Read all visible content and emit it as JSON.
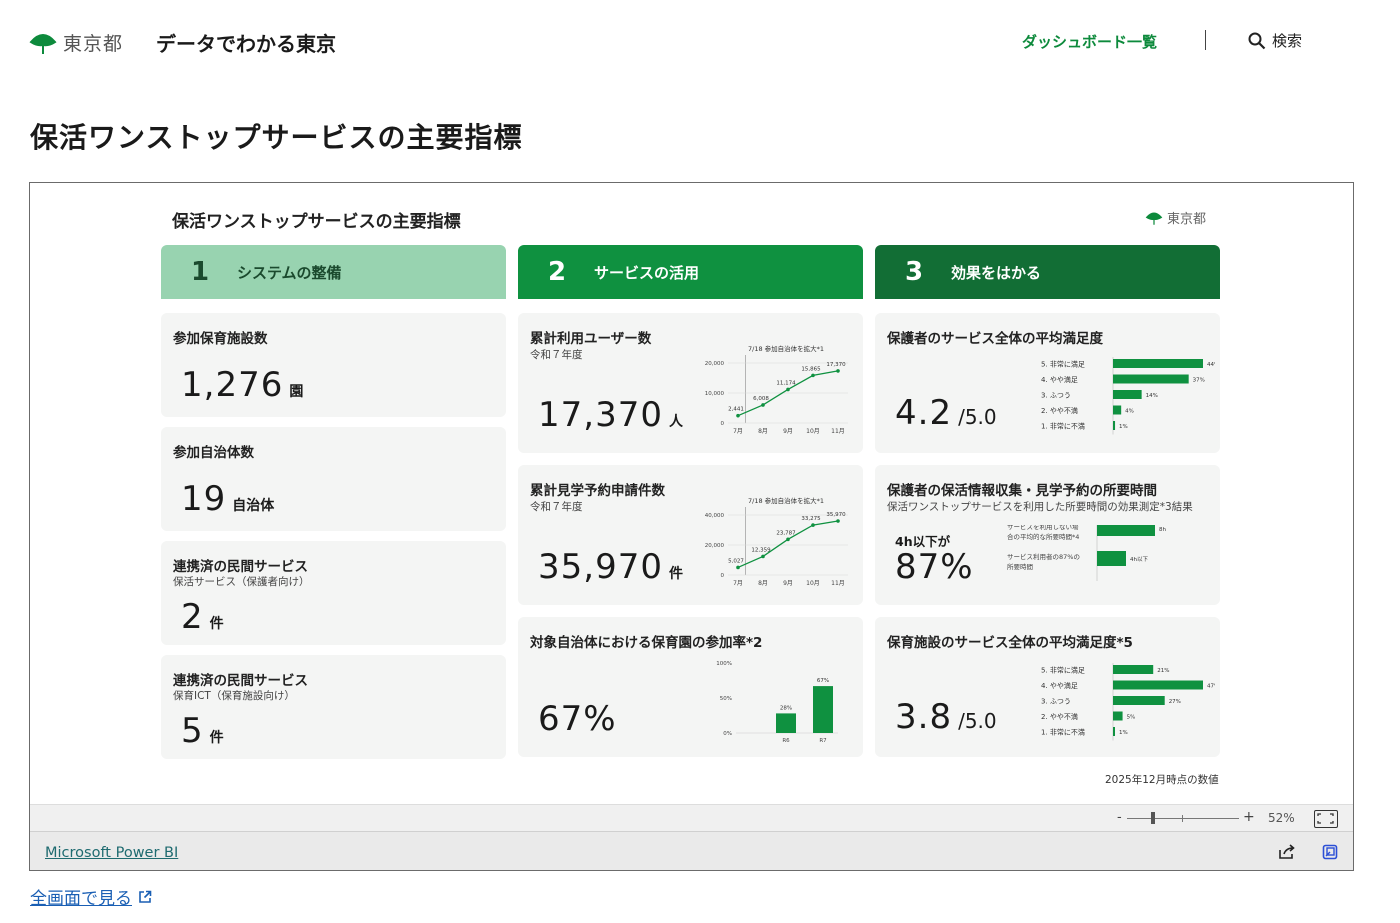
{
  "header": {
    "org_name": "東京都",
    "site_title": "データでわかる東京",
    "nav_dashboard": "ダッシュボード一覧",
    "nav_search": "検索",
    "brand_green": "#0d8a3c"
  },
  "page": {
    "title": "保活ワンストップサービスの主要指標"
  },
  "report": {
    "title": "保活ワンストップサービスの主要指標",
    "logo_text": "東京都",
    "columns": [
      {
        "num": "1",
        "label": "システムの整備",
        "color": "#98d3b0"
      },
      {
        "num": "2",
        "label": "サービスの活用",
        "color": "#0f9140"
      },
      {
        "num": "3",
        "label": "効果をはかる",
        "color": "#126e35"
      }
    ],
    "col1": {
      "facilities": {
        "title": "参加保育施設数",
        "value": "1,276",
        "unit": "園"
      },
      "municipalities": {
        "title": "参加自治体数",
        "value": "19",
        "unit": "自治体"
      },
      "services_parents": {
        "title": "連携済の民間サービス",
        "subtitle": "保活サービス（保護者向け）",
        "value": "2",
        "unit": "件"
      },
      "services_ict": {
        "title": "連携済の民間サービス",
        "subtitle": "保育ICT（保育施設向け）",
        "value": "5",
        "unit": "件"
      }
    },
    "col2": {
      "users": {
        "title": "累計利用ユーザー数",
        "subtitle": "令和７年度",
        "value": "17,370",
        "unit": "人",
        "annotation": "7/18 参加自治体を拡大*1",
        "x": [
          "7月",
          "8月",
          "9月",
          "10月",
          "11月"
        ],
        "yticks": [
          "20,000",
          "10,000",
          "0"
        ],
        "ymax": 20000,
        "points": [
          {
            "m": 0.0,
            "v": 2441,
            "label": "2,441"
          },
          {
            "m": 1.0,
            "v": 6008,
            "label": "6,008"
          },
          {
            "m": 2.0,
            "v": 11174,
            "label": "11,174"
          },
          {
            "m": 3.0,
            "v": 15865,
            "label": "15,865"
          },
          {
            "m": 4.0,
            "v": 17370,
            "label": "17,370"
          }
        ]
      },
      "visits": {
        "title": "累計見学予約申請件数",
        "subtitle": "令和７年度",
        "value": "35,970",
        "unit": "件",
        "annotation": "7/18 参加自治体を拡大*1",
        "x": [
          "7月",
          "8月",
          "9月",
          "10月",
          "11月"
        ],
        "yticks": [
          "40,000",
          "20,000",
          "0"
        ],
        "ymax": 40000,
        "points": [
          {
            "m": 0.0,
            "v": 5027,
            "label": "5,027"
          },
          {
            "m": 1.0,
            "v": 12359,
            "label": "12,359"
          },
          {
            "m": 2.0,
            "v": 23787,
            "label": "23,787"
          },
          {
            "m": 3.0,
            "v": 33275,
            "label": "33,275"
          },
          {
            "m": 4.0,
            "v": 35970,
            "label": "35,970"
          }
        ]
      },
      "participation": {
        "title": "対象自治体における保育園の参加率*2",
        "value": "67%",
        "yticks": [
          "100%",
          "50%",
          "0%"
        ],
        "bars": [
          {
            "cat": "R6",
            "v": 28,
            "label": "28%"
          },
          {
            "cat": "R7",
            "v": 67,
            "label": "67%"
          }
        ]
      }
    },
    "col3": {
      "satisfaction_parents": {
        "title": "保護者のサービス全体の平均満足度",
        "value": "4.2",
        "scale": "/5.0",
        "rows": [
          {
            "label": "5. 非常に満足",
            "v": 44,
            "pct": "44%"
          },
          {
            "label": "4. やや満足",
            "v": 37,
            "pct": "37%"
          },
          {
            "label": "3. ふつう",
            "v": 14,
            "pct": "14%"
          },
          {
            "label": "2. やや不満",
            "v": 4,
            "pct": "4%"
          },
          {
            "label": "1. 非常に不満",
            "v": 1,
            "pct": "1%"
          }
        ]
      },
      "time": {
        "title": "保護者の保活情報収集・見学予約の所要時間",
        "subtitle": "保活ワンストップサービスを利用した所要時間の効果測定*3結果",
        "lead": "4h以下が",
        "value": "87%",
        "rows": [
          {
            "label1": "サービスを利用しない場",
            "label2": "合の平均的な所要時間*4",
            "v": 8,
            "tag": "8h"
          },
          {
            "label1": "サービス利用者の87%の",
            "label2": "所要時間",
            "v": 4,
            "tag": "4h以下"
          }
        ]
      },
      "satisfaction_facilities": {
        "title": "保育施設のサービス全体の平均満足度*5",
        "value": "3.8",
        "scale": "/5.0",
        "rows": [
          {
            "label": "5. 非常に満足",
            "v": 21,
            "pct": "21%"
          },
          {
            "label": "4. やや満足",
            "v": 47,
            "pct": "47%"
          },
          {
            "label": "3. ふつう",
            "v": 27,
            "pct": "27%"
          },
          {
            "label": "2. やや不満",
            "v": 5,
            "pct": "5%"
          },
          {
            "label": "1. 非常に不満",
            "v": 1,
            "pct": "1%"
          }
        ]
      }
    },
    "note": "2025年12月時点の数値"
  },
  "powerbi": {
    "zoom_minus": "-",
    "zoom_plus": "+",
    "zoom_pct": "52%",
    "brand": "Microsoft Power BI"
  },
  "links": {
    "fullscreen": "全画面で見る"
  }
}
